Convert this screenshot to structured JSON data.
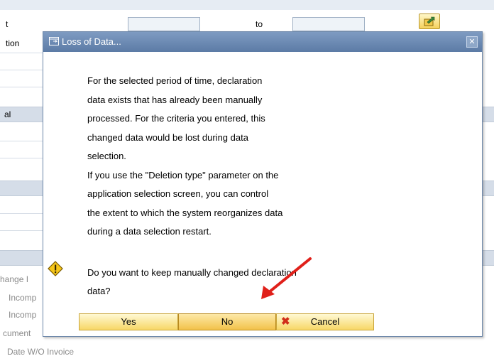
{
  "background": {
    "labels_top": [
      "t",
      "tion"
    ],
    "to_label": "to",
    "section_label": "al",
    "lower_labels": [
      "hange I",
      "Incomp",
      "Incomp",
      "cument",
      "Date W/O Invoice"
    ]
  },
  "dialog": {
    "title": "Loss of Data...",
    "close_glyph": "✕",
    "message_lines": [
      "For the selected period of time, declaration",
      "data exists that has already been manually",
      "processed. For the criteria you entered, this",
      "changed data would be lost during data",
      "selection.",
      "If you use the \"Deletion type\" parameter on the",
      "application selection screen, you can control",
      "the extent to which the system reorganizes data",
      "during a data selection restart."
    ],
    "question_lines": [
      "Do you want to keep manually changed declaration",
      "data?"
    ],
    "buttons": {
      "yes": "Yes",
      "no": "No",
      "cancel": "Cancel"
    }
  },
  "icons": {
    "title_icon": "window-icon",
    "warning": "warning-icon",
    "export": "export-icon",
    "cancel": "cancel-x-icon",
    "annotation": "red-arrow"
  },
  "colors": {
    "titlebar": "#6f8db6",
    "button": "#f7d767",
    "arrow": "#e0201a"
  }
}
